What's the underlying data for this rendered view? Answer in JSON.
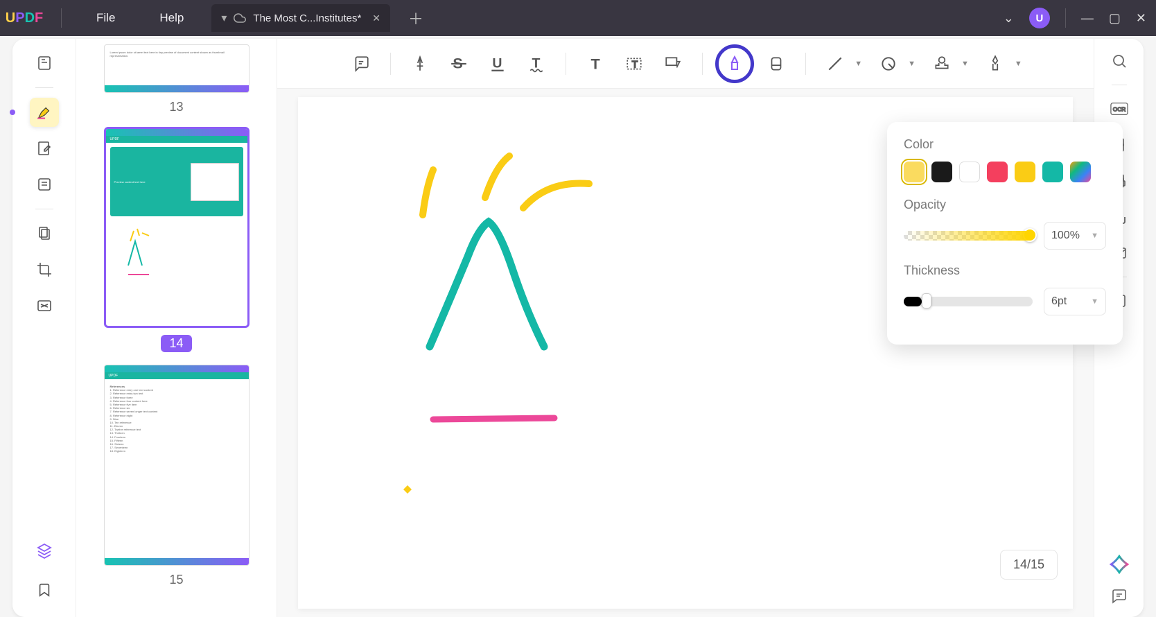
{
  "app": {
    "logo": "UPDF",
    "menus": [
      "File",
      "Help"
    ]
  },
  "tab": {
    "title": "The Most C...Institutes*",
    "modified": true
  },
  "avatar_letter": "U",
  "left_rail": {
    "items": [
      {
        "name": "reader-icon"
      },
      {
        "name": "highlighter-icon",
        "active": true
      },
      {
        "name": "edit-icon"
      },
      {
        "name": "form-icon"
      },
      {
        "name": "organize-icon"
      },
      {
        "name": "crop-icon"
      },
      {
        "name": "redact-icon"
      }
    ],
    "bottom": [
      {
        "name": "layers-icon"
      },
      {
        "name": "bookmark-icon"
      }
    ]
  },
  "thumbnails": [
    {
      "num": "13",
      "selected": false,
      "type": "text"
    },
    {
      "num": "14",
      "selected": true,
      "type": "drawing"
    },
    {
      "num": "15",
      "selected": false,
      "type": "refs",
      "heading": "References"
    }
  ],
  "toolbar": {
    "groups": [
      [
        "comment"
      ],
      [
        "highlighter",
        "strikethrough",
        "underline",
        "squiggly"
      ],
      [
        "text",
        "textbox",
        "callout"
      ],
      [
        "pencil",
        "eraser"
      ],
      [
        "line",
        "shape",
        "stamp",
        "signature"
      ]
    ],
    "selected": "pencil"
  },
  "popover": {
    "color_label": "Color",
    "colors": [
      "#FADB5F",
      "#1a1a1a",
      "#ffffff",
      "#F43F5E",
      "#FACC15",
      "#14B8A6",
      "gradient"
    ],
    "color_selected": 0,
    "opacity_label": "Opacity",
    "opacity_value": "100%",
    "opacity_pct": 100,
    "thickness_label": "Thickness",
    "thickness_value": "6pt",
    "thickness_pct": 14
  },
  "page_counter": "14/15",
  "right_rail": {
    "items": [
      {
        "name": "search-icon"
      },
      {
        "name": "ocr-icon"
      },
      {
        "name": "convert-icon"
      },
      {
        "name": "protect-icon"
      },
      {
        "name": "share-icon"
      },
      {
        "name": "email-icon"
      },
      {
        "name": "save-icon"
      }
    ],
    "bottom": [
      {
        "name": "ai-assistant-icon"
      },
      {
        "name": "chat-icon"
      }
    ]
  }
}
